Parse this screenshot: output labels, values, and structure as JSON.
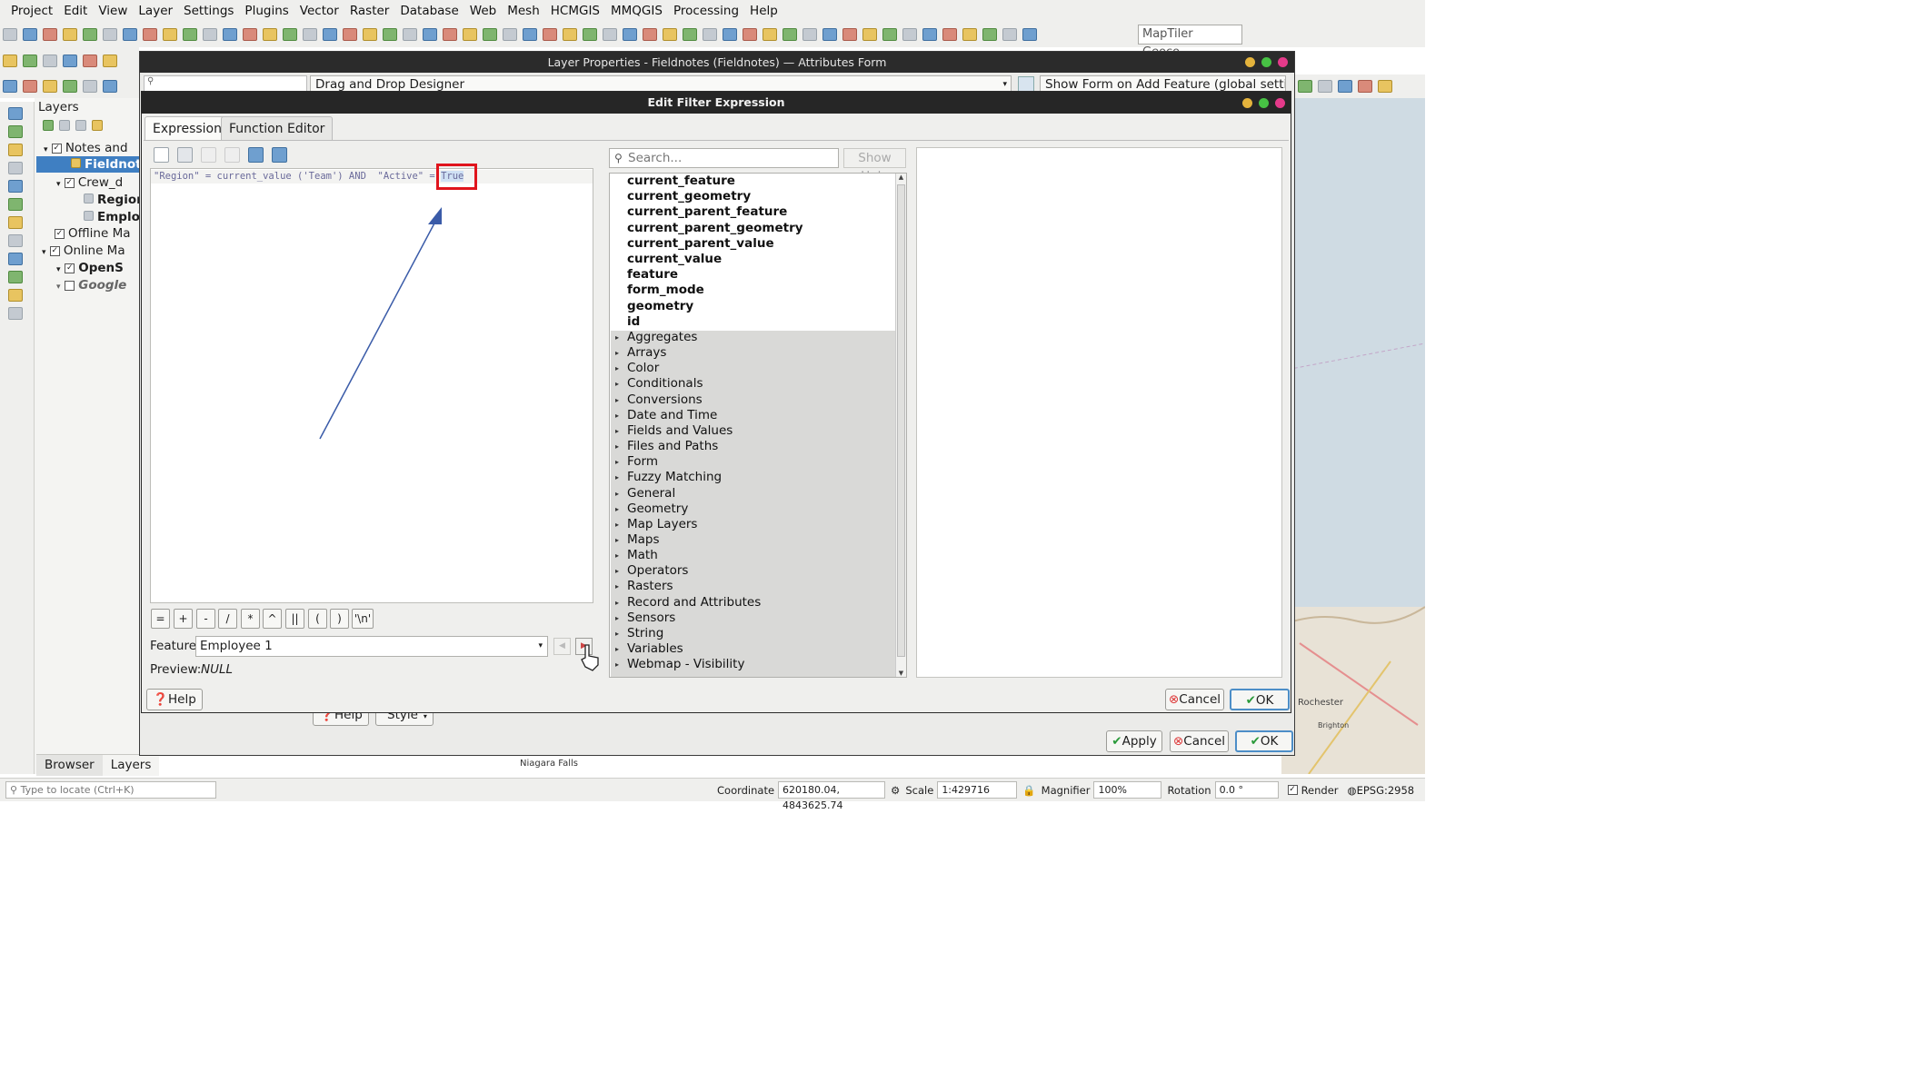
{
  "menu": [
    "Project",
    "Edit",
    "View",
    "Layer",
    "Settings",
    "Plugins",
    "Vector",
    "Raster",
    "Database",
    "Web",
    "Mesh",
    "HCMGIS",
    "MMQGIS",
    "Processing",
    "Help"
  ],
  "toolbar": {
    "geocoder_placeholder": "MapTiler Geoco..."
  },
  "layers_panel": {
    "title": "Layers",
    "items": [
      "Notes and",
      "Fieldnote",
      "Crew_d",
      "Region",
      "Employ",
      "Offline Ma",
      "Online Ma",
      "OpenS",
      "Google"
    ],
    "tabs": [
      "Browser",
      "Layers"
    ],
    "locator_placeholder": "Type to locate (Ctrl+K)"
  },
  "outer_dialog": {
    "title": "Layer Properties - Fieldnotes (Fieldnotes) — Attributes Form",
    "designer": "Drag and Drop Designer",
    "form_option": "Show Form on Add Feature (global settings)",
    "help": "Help",
    "style": "Style",
    "apply": "Apply",
    "cancel": "Cancel",
    "ok": "OK"
  },
  "dialog": {
    "title": "Edit Filter Expression",
    "tabs": [
      "Expression",
      "Function Editor"
    ],
    "expression": {
      "part1": "\"Region\" = current_value ('Team') AND  \"Active\" = ",
      "highlighted": "True"
    },
    "operators": [
      "=",
      "+",
      "-",
      "/",
      "*",
      "^",
      "||",
      "(",
      ")",
      "'\\n'"
    ],
    "feature_label": "Feature",
    "feature_value": "Employee 1",
    "preview_label": "Preview:",
    "preview_value": "NULL",
    "search_placeholder": "Search...",
    "show_help": "Show Help",
    "functions": [
      "current_feature",
      "current_geometry",
      "current_parent_feature",
      "current_parent_geometry",
      "current_parent_value",
      "current_value",
      "feature",
      "form_mode",
      "geometry",
      "id"
    ],
    "groups": [
      "Aggregates",
      "Arrays",
      "Color",
      "Conditionals",
      "Conversions",
      "Date and Time",
      "Fields and Values",
      "Files and Paths",
      "Form",
      "Fuzzy Matching",
      "General",
      "Geometry",
      "Map Layers",
      "Maps",
      "Math",
      "Operators",
      "Rasters",
      "Record and Attributes",
      "Sensors",
      "String",
      "Variables",
      "Webmap - Visibility"
    ],
    "help": "Help",
    "cancel": "Cancel",
    "ok": "OK"
  },
  "statusbar": {
    "coordinate_label": "Coordinate",
    "coordinate": "620180.04, 4843625.74",
    "scale_label": "Scale",
    "scale": "1:429716",
    "magnifier_label": "Magnifier",
    "magnifier": "100%",
    "rotation_label": "Rotation",
    "rotation": "0.0 °",
    "render": "Render",
    "crs": "EPSG:2958"
  },
  "map_labels": [
    "Niagara Falls",
    "Rochester",
    "Brighton"
  ],
  "colors": {
    "accent": "#4d8ec7",
    "highlight_box": "#e0141c",
    "arrow": "#3a5ba8",
    "titlebar": "#262626"
  }
}
